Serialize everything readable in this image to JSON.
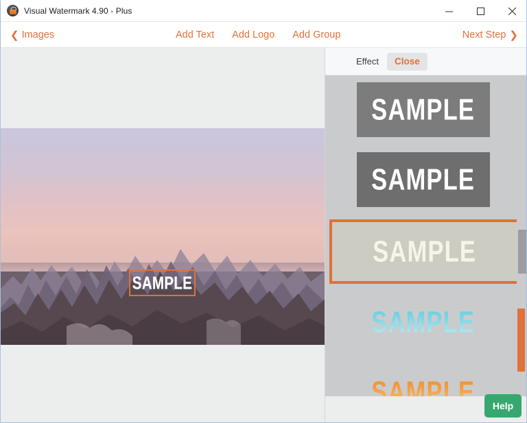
{
  "window": {
    "title": "Visual Watermark 4.90 - Plus",
    "app_icon": "padlock-icon",
    "controls": {
      "minimize": "minimize-icon",
      "maximize": "maximize-icon",
      "close": "close-icon"
    }
  },
  "toolbar": {
    "back_chevron": "❮",
    "back_label": "Images",
    "add_text": "Add Text",
    "add_logo": "Add Logo",
    "add_group": "Add Group",
    "next_label": "Next Step",
    "next_chevron": "❯",
    "accent_color": "#e2703a"
  },
  "canvas": {
    "watermark_text": "SAMPLE",
    "selection_color": "#e2703a"
  },
  "effects": {
    "title": "Effect",
    "close_label": "Close",
    "items": [
      {
        "text": "SAMPLE",
        "style": "white-on-dark-gray"
      },
      {
        "text": "SAMPLE",
        "style": "white-on-gray"
      },
      {
        "text": "SAMPLE",
        "style": "cream-on-beige-selected"
      },
      {
        "text": "SAMPLE",
        "style": "cyan-gradient"
      },
      {
        "text": "SAMPLE",
        "style": "orange-gradient"
      }
    ],
    "selected_index": 2,
    "panel_background": "#c9cbcd",
    "selected_border_color": "#e2703a"
  },
  "help": {
    "label": "Help",
    "color": "#36a86f"
  }
}
